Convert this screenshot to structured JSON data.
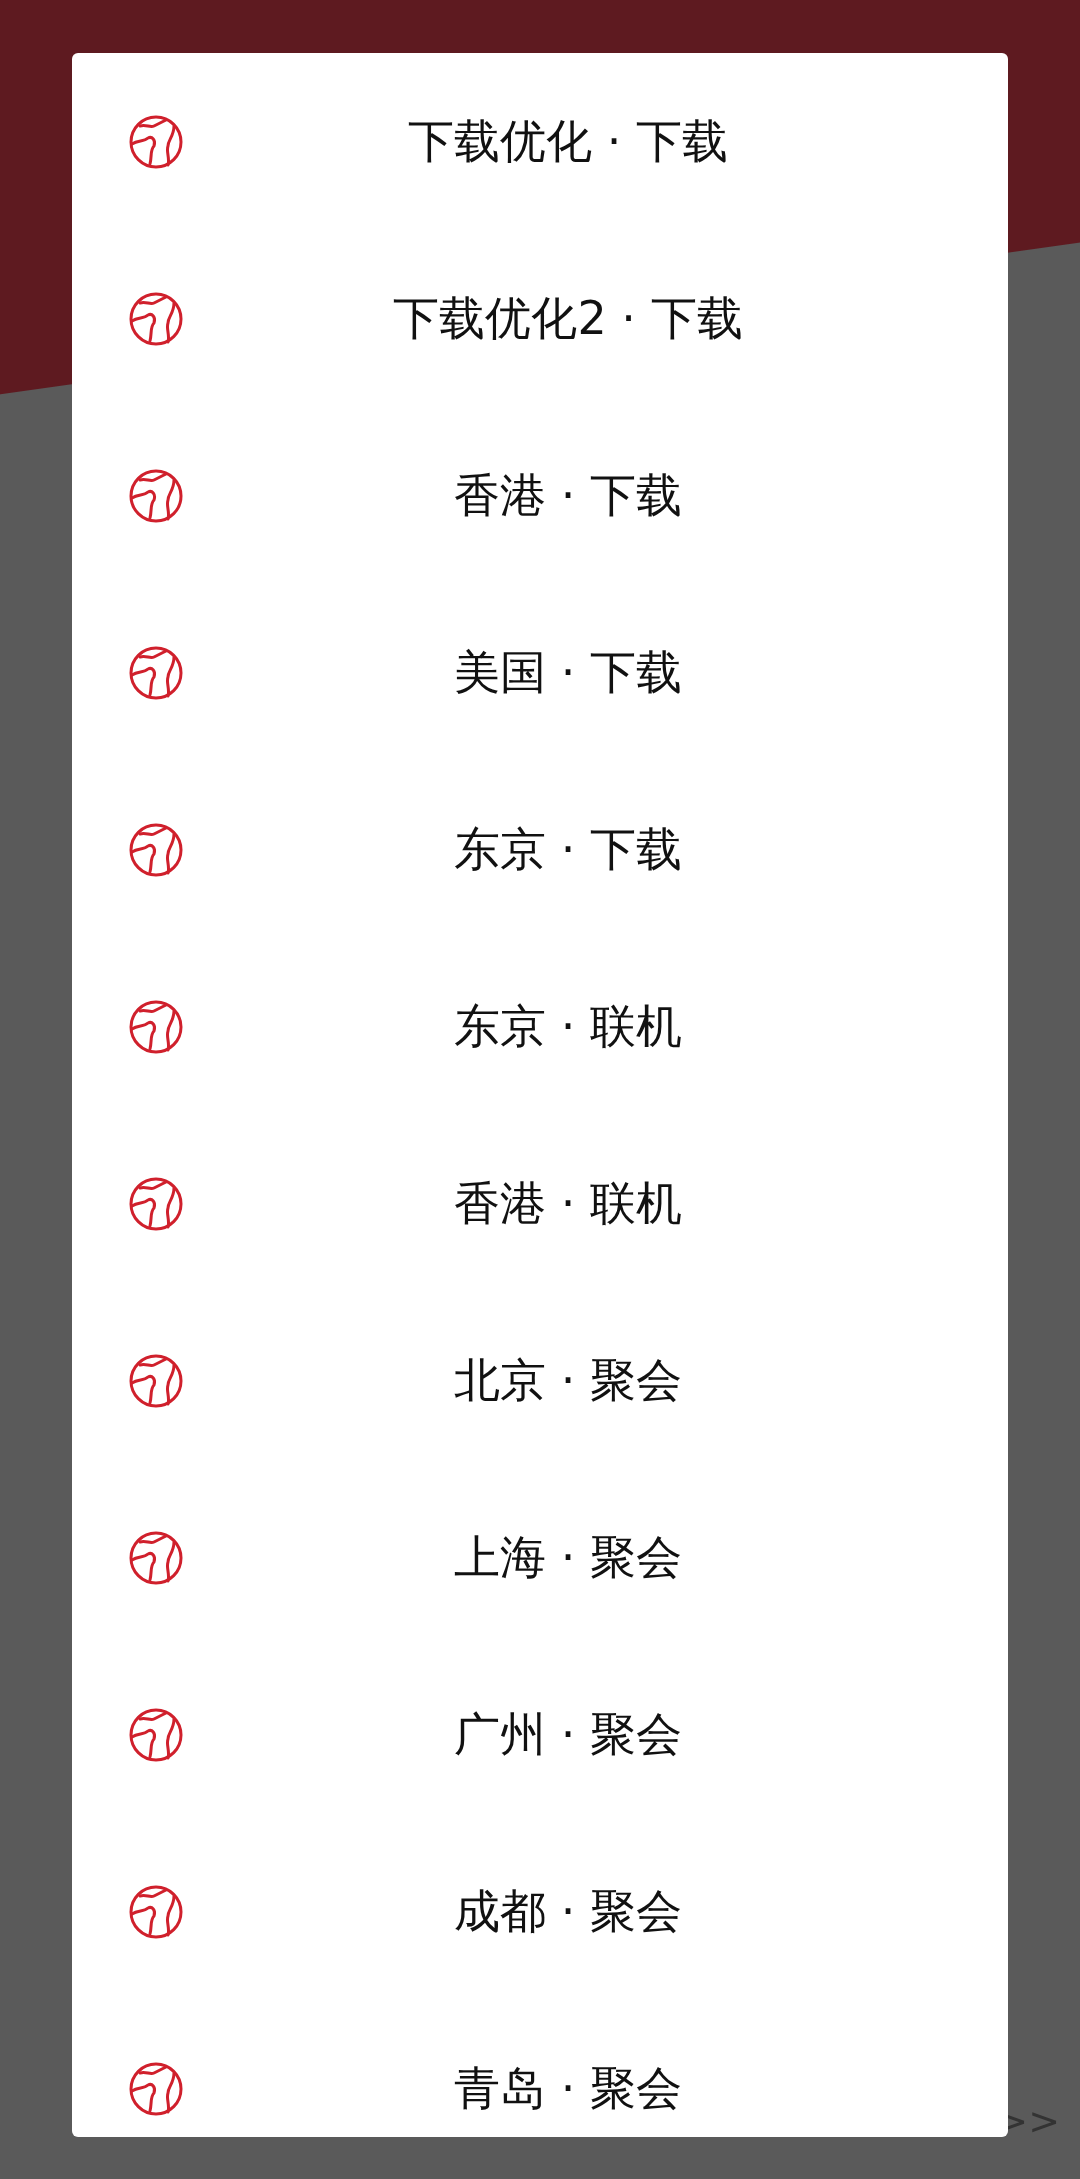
{
  "background": {
    "link_arrow": ">>"
  },
  "dialog": {
    "items": [
      {
        "label": "下载优化 · 下载"
      },
      {
        "label": "下载优化2 · 下载"
      },
      {
        "label": "香港 · 下载"
      },
      {
        "label": "美国 · 下载"
      },
      {
        "label": "东京 · 下载"
      },
      {
        "label": "东京 · 联机"
      },
      {
        "label": "香港 · 联机"
      },
      {
        "label": "北京 · 聚会"
      },
      {
        "label": "上海 · 聚会"
      },
      {
        "label": "广州 · 聚会"
      },
      {
        "label": "成都 · 聚会"
      },
      {
        "label": "青岛 · 聚会"
      }
    ]
  }
}
